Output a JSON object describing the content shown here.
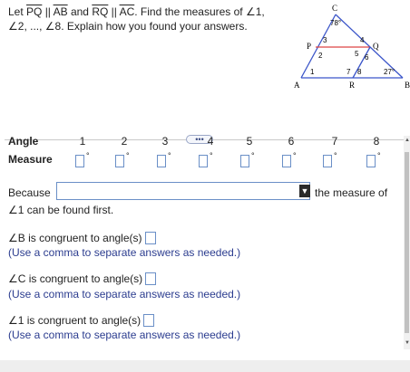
{
  "question": {
    "part1": "Let ",
    "pq": "PQ",
    "mid1": " || ",
    "ab": "AB",
    "mid2": " and ",
    "rq": "RQ",
    "mid3": " || ",
    "ac": "AC",
    "tail1": ". Find the measures of ",
    "angle1": "1,",
    "line2a": "2, ..., ",
    "angle8": "8. Explain how you found your answers."
  },
  "figure": {
    "vertices": {
      "c": "C",
      "p": "P",
      "q": "Q",
      "a": "A",
      "r": "R",
      "b": "B"
    },
    "angle_labels": [
      "1",
      "2",
      "3",
      "4",
      "5",
      "6",
      "7",
      "8"
    ],
    "given": {
      "c": "78°",
      "b": "27°"
    }
  },
  "expand_label": "•••",
  "table": {
    "angle_header": "Angle",
    "measure_header": "Measure",
    "columns": [
      "1",
      "2",
      "3",
      "4",
      "5",
      "6",
      "7",
      "8"
    ],
    "degree_symbol": "°"
  },
  "explain": {
    "because": "Because",
    "after_dropdown": "the measure of",
    "line2": "∠1 can be found first.",
    "dropdown_arrow": "▼"
  },
  "prompts": [
    {
      "text": "∠B is congruent to angle(s)",
      "hint": "(Use a comma to separate answers as needed.)"
    },
    {
      "text": "∠C is congruent to angle(s)",
      "hint": "(Use a comma to separate answers as needed.)"
    },
    {
      "text": "∠1 is congruent to angle(s)",
      "hint": "(Use a comma to separate answers as needed.)"
    }
  ],
  "angle_glyph": "∠"
}
